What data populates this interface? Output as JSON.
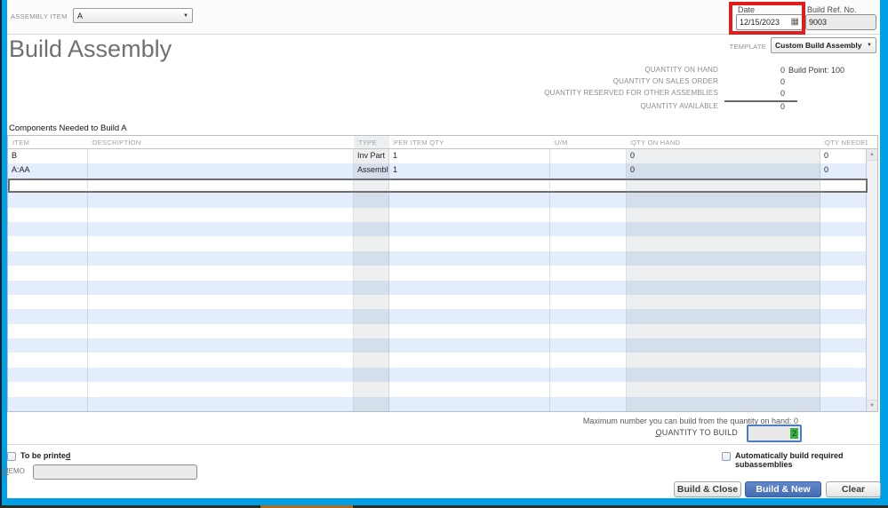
{
  "header": {
    "assembly_item_label": "ASSEMBLY ITEM",
    "assembly_item_value": "A",
    "date_label": "Date",
    "date_value": "12/15/2023",
    "build_ref_label": "Build Ref. No.",
    "build_ref_value": "9003",
    "title": "Build Assembly",
    "template_label": "TEMPLATE",
    "template_value": "Custom Build Assembly"
  },
  "quantities": {
    "rows": [
      {
        "label": "QUANTITY ON HAND",
        "value": "0",
        "extra": "Build Point: 100"
      },
      {
        "label": "QUANTITY ON SALES ORDER",
        "value": "0",
        "extra": ""
      },
      {
        "label": "QUANTITY RESERVED FOR OTHER ASSEMBLIES",
        "value": "0",
        "extra": ""
      },
      {
        "label": "QUANTITY AVAILABLE",
        "value": "0",
        "extra": ""
      }
    ]
  },
  "components": {
    "title": "Components Needed to Build A",
    "columns": [
      "ITEM",
      "DESCRIPTION",
      "TYPE",
      "PER ITEM QTY",
      "U/M",
      "QTY ON HAND",
      "QTY NEEDED"
    ],
    "rows": [
      {
        "item": "B",
        "description": "",
        "type": "Inv Part",
        "per_item_qty": "1",
        "um": "",
        "qty_on_hand": "0",
        "qty_needed": "0"
      },
      {
        "item": "A:AA",
        "description": "",
        "type": "Assembly",
        "per_item_qty": "1",
        "um": "",
        "qty_on_hand": "0",
        "qty_needed": "0"
      }
    ],
    "edit_row_index": 2,
    "empty_row_count": 16,
    "scroll_up_glyph": "▲",
    "scroll_down_glyph": "▼"
  },
  "build_section": {
    "max_text": "Maximum number you can build from the quantity on hand: 0",
    "qty_label": {
      "mn": "Q",
      "post": "UANTITY TO BUILD"
    },
    "qty_value": "2"
  },
  "footer": {
    "to_be_printed": {
      "pre": "To be printe",
      "mn": "d"
    },
    "memo": {
      "mn": "M",
      "post": "EMO"
    },
    "memo_value": "",
    "auto_build_label": "Automatically build required subassemblies",
    "buttons": {
      "build_close": "Build & Close",
      "build_new": "Build & New",
      "clear": "Clear"
    }
  },
  "colors": {
    "frame_blue": "#00a0e6",
    "highlight_red": "#e01c1c",
    "primary_button_blue": "#44,6c,b0",
    "row_alt_blue": "#e3edfb",
    "selection_green": "#3fae46"
  }
}
